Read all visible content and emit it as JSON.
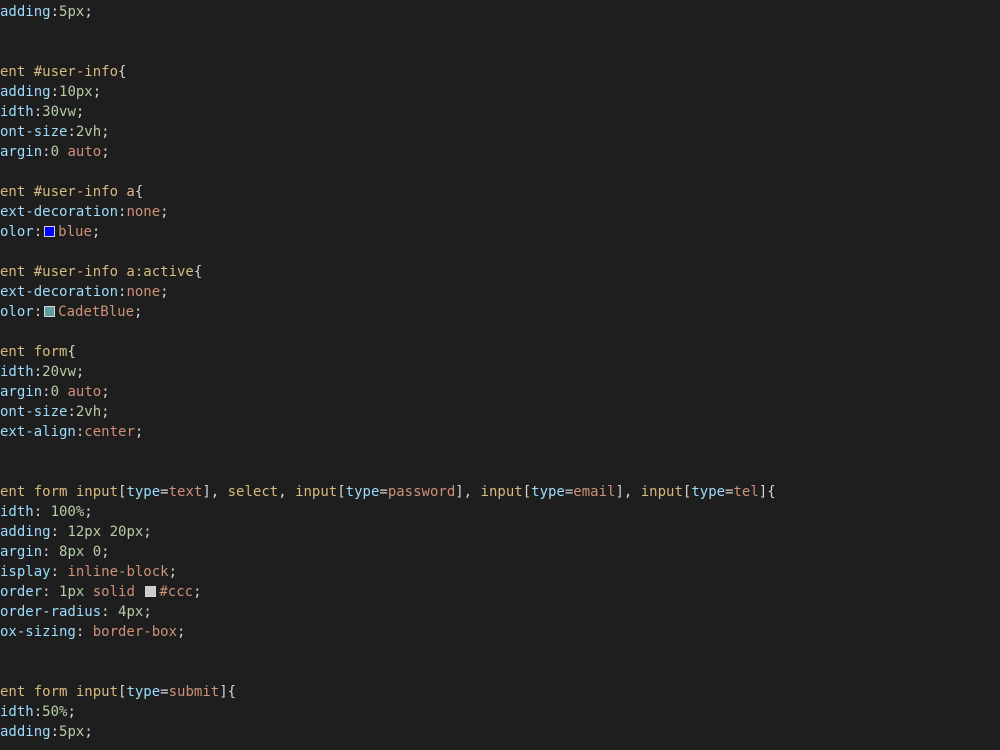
{
  "editor": {
    "background": "#1e1e1e",
    "token_colors": {
      "selector": "#d7ba7d",
      "property": "#9cdcfe",
      "value": "#ce9178",
      "number": "#b5cea8",
      "punctuation": "#d4d4d4"
    },
    "lines": [
      {
        "tokens": [
          {
            "t": "prop",
            "v": "adding"
          },
          {
            "t": "punc",
            "v": ":"
          },
          {
            "t": "num",
            "v": "5px"
          },
          {
            "t": "punc",
            "v": ";"
          }
        ]
      },
      {
        "tokens": []
      },
      {
        "tokens": []
      },
      {
        "tokens": [
          {
            "t": "sel",
            "v": "ent #user-info"
          },
          {
            "t": "punc",
            "v": "{"
          }
        ]
      },
      {
        "tokens": [
          {
            "t": "prop",
            "v": "adding"
          },
          {
            "t": "punc",
            "v": ":"
          },
          {
            "t": "num",
            "v": "10px"
          },
          {
            "t": "punc",
            "v": ";"
          }
        ]
      },
      {
        "tokens": [
          {
            "t": "prop",
            "v": "idth"
          },
          {
            "t": "punc",
            "v": ":"
          },
          {
            "t": "num",
            "v": "30vw"
          },
          {
            "t": "punc",
            "v": ";"
          }
        ]
      },
      {
        "tokens": [
          {
            "t": "prop",
            "v": "ont-size"
          },
          {
            "t": "punc",
            "v": ":"
          },
          {
            "t": "num",
            "v": "2vh"
          },
          {
            "t": "punc",
            "v": ";"
          }
        ]
      },
      {
        "tokens": [
          {
            "t": "prop",
            "v": "argin"
          },
          {
            "t": "punc",
            "v": ":"
          },
          {
            "t": "num",
            "v": "0"
          },
          {
            "t": "punc",
            "v": " "
          },
          {
            "t": "val",
            "v": "auto"
          },
          {
            "t": "punc",
            "v": ";"
          }
        ]
      },
      {
        "tokens": []
      },
      {
        "tokens": [
          {
            "t": "sel",
            "v": "ent #user-info a"
          },
          {
            "t": "punc",
            "v": "{"
          }
        ]
      },
      {
        "tokens": [
          {
            "t": "prop",
            "v": "ext-decoration"
          },
          {
            "t": "punc",
            "v": ":"
          },
          {
            "t": "val",
            "v": "none"
          },
          {
            "t": "punc",
            "v": ";"
          }
        ]
      },
      {
        "tokens": [
          {
            "t": "prop",
            "v": "olor"
          },
          {
            "t": "punc",
            "v": ":"
          },
          {
            "t": "swatch",
            "color": "#0000ff"
          },
          {
            "t": "val",
            "v": "blue"
          },
          {
            "t": "punc",
            "v": ";"
          }
        ]
      },
      {
        "tokens": []
      },
      {
        "tokens": [
          {
            "t": "sel",
            "v": "ent #user-info a:active"
          },
          {
            "t": "punc",
            "v": "{"
          }
        ]
      },
      {
        "tokens": [
          {
            "t": "prop",
            "v": "ext-decoration"
          },
          {
            "t": "punc",
            "v": ":"
          },
          {
            "t": "val",
            "v": "none"
          },
          {
            "t": "punc",
            "v": ";"
          }
        ]
      },
      {
        "tokens": [
          {
            "t": "prop",
            "v": "olor"
          },
          {
            "t": "punc",
            "v": ":"
          },
          {
            "t": "swatch",
            "color": "#5f9ea0"
          },
          {
            "t": "val",
            "v": "CadetBlue"
          },
          {
            "t": "punc",
            "v": ";"
          }
        ]
      },
      {
        "tokens": []
      },
      {
        "tokens": [
          {
            "t": "sel",
            "v": "ent form"
          },
          {
            "t": "punc",
            "v": "{"
          }
        ]
      },
      {
        "tokens": [
          {
            "t": "prop",
            "v": "idth"
          },
          {
            "t": "punc",
            "v": ":"
          },
          {
            "t": "num",
            "v": "20vw"
          },
          {
            "t": "punc",
            "v": ";"
          }
        ]
      },
      {
        "tokens": [
          {
            "t": "prop",
            "v": "argin"
          },
          {
            "t": "punc",
            "v": ":"
          },
          {
            "t": "num",
            "v": "0"
          },
          {
            "t": "punc",
            "v": " "
          },
          {
            "t": "val",
            "v": "auto"
          },
          {
            "t": "punc",
            "v": ";"
          }
        ]
      },
      {
        "tokens": [
          {
            "t": "prop",
            "v": "ont-size"
          },
          {
            "t": "punc",
            "v": ":"
          },
          {
            "t": "num",
            "v": "2vh"
          },
          {
            "t": "punc",
            "v": ";"
          }
        ]
      },
      {
        "tokens": [
          {
            "t": "prop",
            "v": "ext-align"
          },
          {
            "t": "punc",
            "v": ":"
          },
          {
            "t": "val",
            "v": "center"
          },
          {
            "t": "punc",
            "v": ";"
          }
        ]
      },
      {
        "tokens": []
      },
      {
        "tokens": []
      },
      {
        "tokens": [
          {
            "t": "sel",
            "v": "ent form input"
          },
          {
            "t": "punc",
            "v": "["
          },
          {
            "t": "prop",
            "v": "type"
          },
          {
            "t": "punc",
            "v": "="
          },
          {
            "t": "val",
            "v": "text"
          },
          {
            "t": "punc",
            "v": "], "
          },
          {
            "t": "sel",
            "v": "select"
          },
          {
            "t": "punc",
            "v": ", "
          },
          {
            "t": "sel",
            "v": "input"
          },
          {
            "t": "punc",
            "v": "["
          },
          {
            "t": "prop",
            "v": "type"
          },
          {
            "t": "punc",
            "v": "="
          },
          {
            "t": "val",
            "v": "password"
          },
          {
            "t": "punc",
            "v": "], "
          },
          {
            "t": "sel",
            "v": "input"
          },
          {
            "t": "punc",
            "v": "["
          },
          {
            "t": "prop",
            "v": "type"
          },
          {
            "t": "punc",
            "v": "="
          },
          {
            "t": "val",
            "v": "email"
          },
          {
            "t": "punc",
            "v": "], "
          },
          {
            "t": "sel",
            "v": "input"
          },
          {
            "t": "punc",
            "v": "["
          },
          {
            "t": "prop",
            "v": "type"
          },
          {
            "t": "punc",
            "v": "="
          },
          {
            "t": "val",
            "v": "tel"
          },
          {
            "t": "punc",
            "v": "]{"
          }
        ]
      },
      {
        "tokens": [
          {
            "t": "prop",
            "v": "idth"
          },
          {
            "t": "punc",
            "v": ": "
          },
          {
            "t": "num",
            "v": "100%"
          },
          {
            "t": "punc",
            "v": ";"
          }
        ]
      },
      {
        "tokens": [
          {
            "t": "prop",
            "v": "adding"
          },
          {
            "t": "punc",
            "v": ": "
          },
          {
            "t": "num",
            "v": "12px 20px"
          },
          {
            "t": "punc",
            "v": ";"
          }
        ]
      },
      {
        "tokens": [
          {
            "t": "prop",
            "v": "argin"
          },
          {
            "t": "punc",
            "v": ": "
          },
          {
            "t": "num",
            "v": "8px 0"
          },
          {
            "t": "punc",
            "v": ";"
          }
        ]
      },
      {
        "tokens": [
          {
            "t": "prop",
            "v": "isplay"
          },
          {
            "t": "punc",
            "v": ": "
          },
          {
            "t": "val",
            "v": "inline-block"
          },
          {
            "t": "punc",
            "v": ";"
          }
        ]
      },
      {
        "tokens": [
          {
            "t": "prop",
            "v": "order"
          },
          {
            "t": "punc",
            "v": ": "
          },
          {
            "t": "num",
            "v": "1px"
          },
          {
            "t": "punc",
            "v": " "
          },
          {
            "t": "val",
            "v": "solid"
          },
          {
            "t": "punc",
            "v": " "
          },
          {
            "t": "swatch",
            "color": "#cccccc"
          },
          {
            "t": "val",
            "v": "#ccc"
          },
          {
            "t": "punc",
            "v": ";"
          }
        ]
      },
      {
        "tokens": [
          {
            "t": "prop",
            "v": "order-radius"
          },
          {
            "t": "punc",
            "v": ": "
          },
          {
            "t": "num",
            "v": "4px"
          },
          {
            "t": "punc",
            "v": ";"
          }
        ]
      },
      {
        "tokens": [
          {
            "t": "prop",
            "v": "ox-sizing"
          },
          {
            "t": "punc",
            "v": ": "
          },
          {
            "t": "val",
            "v": "border-box"
          },
          {
            "t": "punc",
            "v": ";"
          }
        ]
      },
      {
        "tokens": []
      },
      {
        "tokens": []
      },
      {
        "tokens": [
          {
            "t": "sel",
            "v": "ent form input"
          },
          {
            "t": "punc",
            "v": "["
          },
          {
            "t": "prop",
            "v": "type"
          },
          {
            "t": "punc",
            "v": "="
          },
          {
            "t": "val",
            "v": "submit"
          },
          {
            "t": "punc",
            "v": "]{"
          }
        ]
      },
      {
        "tokens": [
          {
            "t": "prop",
            "v": "idth"
          },
          {
            "t": "punc",
            "v": ":"
          },
          {
            "t": "num",
            "v": "50%"
          },
          {
            "t": "punc",
            "v": ";"
          }
        ]
      },
      {
        "tokens": [
          {
            "t": "prop",
            "v": "adding"
          },
          {
            "t": "punc",
            "v": ":"
          },
          {
            "t": "num",
            "v": "5px"
          },
          {
            "t": "punc",
            "v": ";"
          }
        ]
      }
    ]
  }
}
